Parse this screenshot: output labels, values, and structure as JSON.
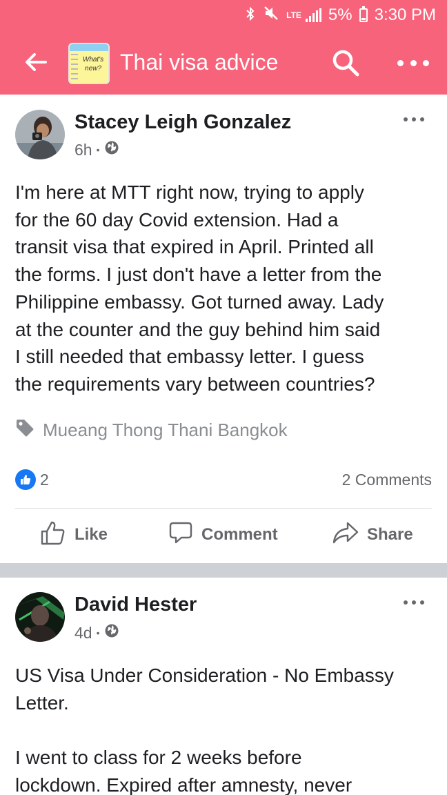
{
  "status_bar": {
    "battery": "5%",
    "time": "3:30 PM",
    "network": "LTE",
    "icons": [
      "bluetooth-icon",
      "mute-icon",
      "lte-icon",
      "signal-icon",
      "battery-icon"
    ]
  },
  "header": {
    "title": "Thai visa advice",
    "group_logo_text": "What's new?",
    "icons": [
      "back-arrow-icon",
      "search-icon",
      "more-icon"
    ],
    "color": "#f7637a"
  },
  "posts": [
    {
      "author": "Stacey Leigh Gonzalez",
      "time": "6h",
      "privacy_icon": "globe-icon",
      "text": "I'm here at MTT right now, trying to apply\nfor the 60 day Covid extension. Had a\ntransit visa that expired in April. Printed all\nthe forms. I just don't have a letter from the\nPhilippine embassy. Got turned away. Lady\nat the counter and the guy behind him said\nI still needed that embassy letter. I guess\nthe requirements vary between countries?",
      "location": "Mueang Thong Thani Bangkok",
      "likes": "2",
      "comments": "2 Comments",
      "actions": {
        "like": "Like",
        "comment": "Comment",
        "share": "Share"
      }
    },
    {
      "author": "David Hester",
      "time": "4d",
      "privacy_icon": "globe-icon",
      "text": "US Visa Under Consideration - No Embassy\nLetter.\n\nI went to class for 2 weeks before\nlockdown. Expired after amnesty, never"
    }
  ],
  "colors": {
    "like_blue": "#1877f2",
    "secondary_text": "#65676b",
    "feed_separator": "#cdd0d4"
  }
}
